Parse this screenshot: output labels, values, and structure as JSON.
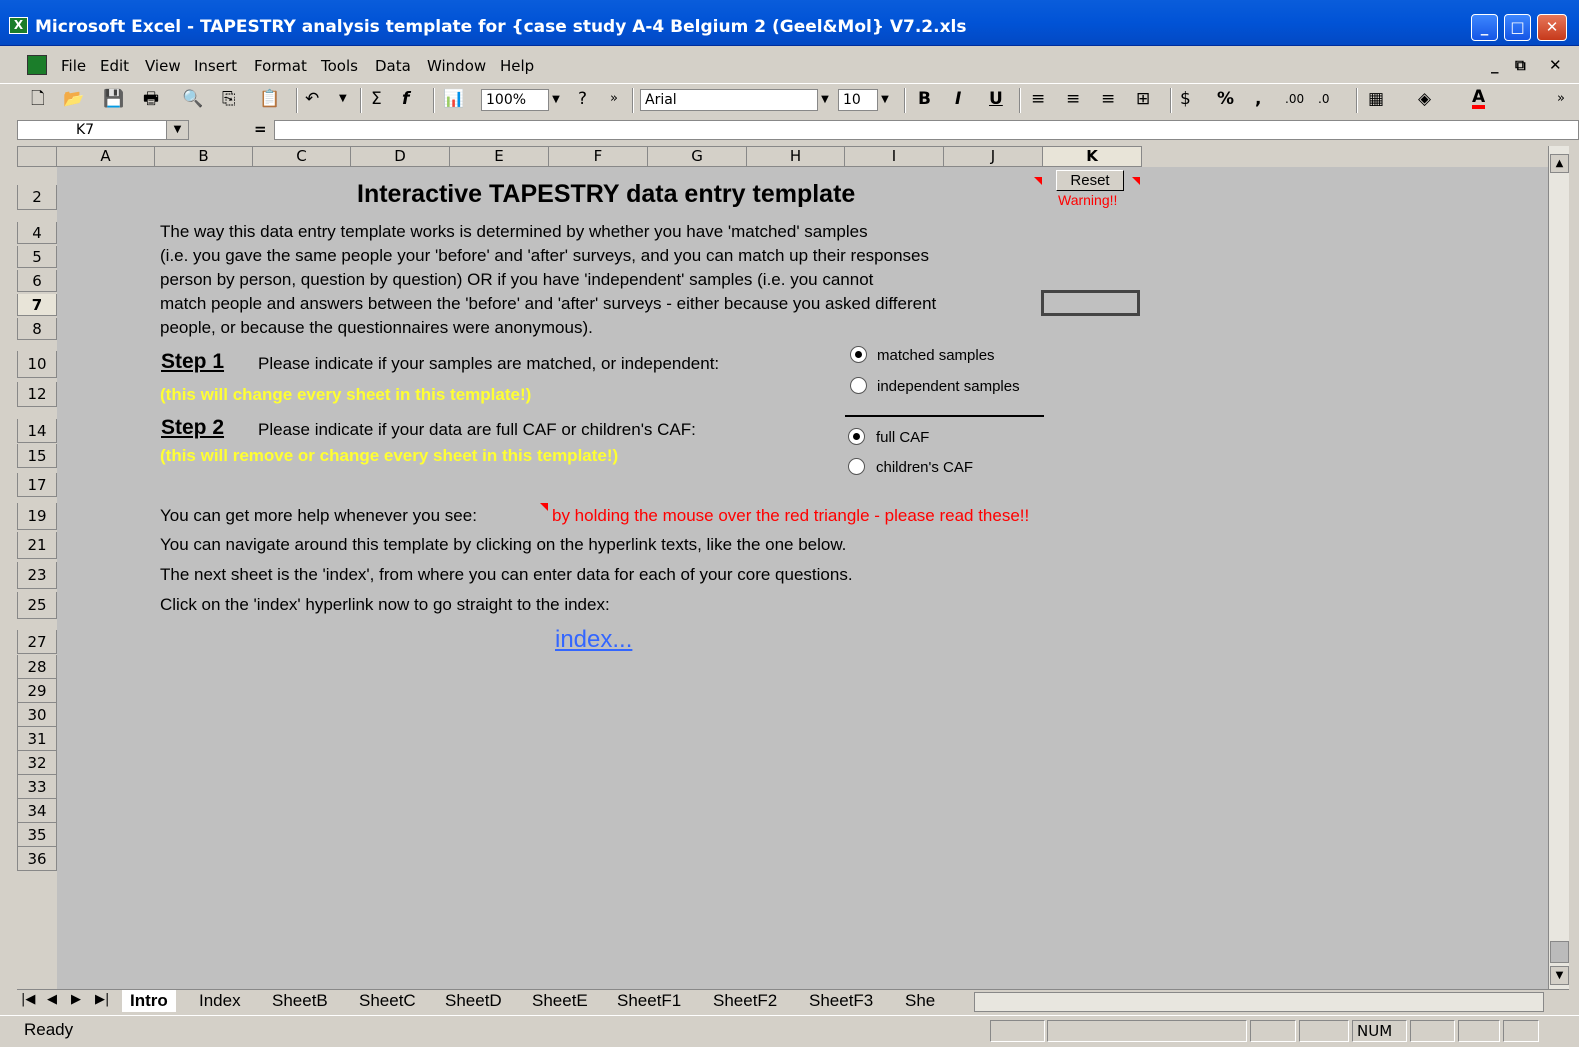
{
  "window": {
    "title": "Microsoft Excel - TAPESTRY analysis template for {case study A-4 Belgium 2 (Geel&Mol} V7.2.xls"
  },
  "menu": [
    "File",
    "Edit",
    "View",
    "Insert",
    "Format",
    "Tools",
    "Data",
    "Window",
    "Help"
  ],
  "toolbar": {
    "zoom": "100%",
    "font": "Arial",
    "size": "10"
  },
  "formula_bar": {
    "cell_ref": "K7",
    "eq": "=",
    "value": ""
  },
  "columns": [
    "A",
    "B",
    "C",
    "D",
    "E",
    "F",
    "G",
    "H",
    "I",
    "J",
    "K"
  ],
  "rows": [
    "2",
    "4",
    "5",
    "6",
    "7",
    "8",
    "10",
    "12",
    "14",
    "15",
    "17",
    "19",
    "21",
    "23",
    "25",
    "27",
    "28",
    "29",
    "30",
    "31",
    "32",
    "33",
    "34",
    "35",
    "36"
  ],
  "sheet": {
    "title": "Interactive TAPESTRY data entry template",
    "reset_label": "Reset",
    "warning": "Warning!!",
    "intro_lines": [
      "The way this data entry template works is determined by whether you have 'matched' samples",
      "(i.e. you gave the same people your 'before' and 'after' surveys, and you can match up their responses",
      "person by person, question by question) OR if you have 'independent' samples (i.e. you cannot",
      "match people and answers between the 'before' and 'after' surveys - either because you asked different",
      "people, or because the questionnaires were anonymous)."
    ],
    "step1": {
      "label": "Step 1",
      "text": "Please indicate if your samples are matched, or independent:",
      "note": "(this will change every sheet in this template!)"
    },
    "step2": {
      "label": "Step 2",
      "text": "Please indicate if your data are full CAF or children's CAF:",
      "note": "(this will remove or change every sheet in this template!)"
    },
    "options1": [
      {
        "label": "matched samples",
        "selected": true
      },
      {
        "label": "independent samples",
        "selected": false
      }
    ],
    "options2": [
      {
        "label": "full CAF",
        "selected": true
      },
      {
        "label": "children's CAF",
        "selected": false
      }
    ],
    "help_text": "You can get more help whenever you see:",
    "help_red": "by holding the mouse over the red triangle - please read these!!",
    "nav_text": "You can navigate around this template by clicking on the hyperlink texts, like the one below.",
    "next_text": "The next sheet is the 'index', from where you can enter data for each of your core questions.",
    "click_text": "Click on the 'index' hyperlink now to go straight to the index:",
    "index_link": "index..."
  },
  "tabs": [
    "Intro",
    "Index",
    "SheetB",
    "SheetC",
    "SheetD",
    "SheetE",
    "SheetF1",
    "SheetF2",
    "SheetF3",
    "She"
  ],
  "status": {
    "ready": "Ready",
    "num": "NUM"
  }
}
